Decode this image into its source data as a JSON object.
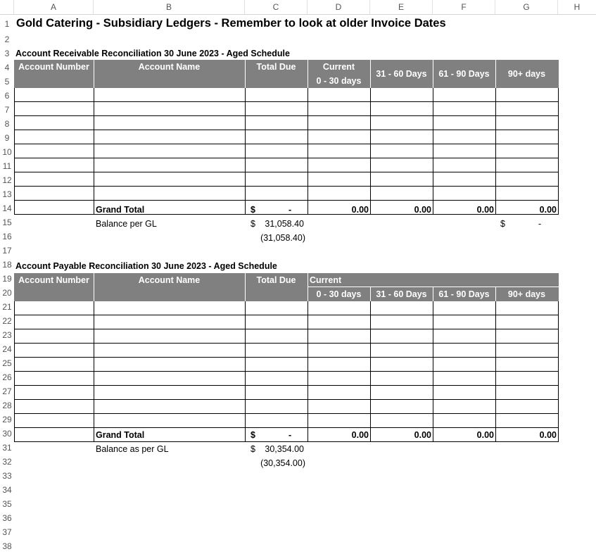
{
  "columns": [
    "A",
    "B",
    "C",
    "D",
    "E",
    "F",
    "G",
    "H"
  ],
  "title": "Gold Catering - Subsidiary Ledgers - Remember to look at older Invoice Dates",
  "ar": {
    "heading": "Account Receivable Reconciliation 30 June 2023 - Aged Schedule",
    "headers": {
      "account_number": "Account Number",
      "account_name": "Account Name",
      "total_due": "Total Due",
      "current": "Current",
      "current_range": "0 - 30 days",
      "d31_60": "31 - 60 Days",
      "d61_90": "61 - 90 Days",
      "d90": "90+ days"
    },
    "grand_total_label": "Grand Total",
    "grand_total_currency": "$",
    "grand_total_dash": "-",
    "totals": [
      "0.00",
      "0.00",
      "0.00",
      "0.00"
    ],
    "balance_label": "Balance per GL",
    "balance_currency": "$",
    "balance_value": "31,058.40",
    "difference": "(31,058.40)",
    "g15_currency": "$",
    "g15_dash": "-"
  },
  "ap": {
    "heading": "Account Payable Reconciliation 30 June 2023 - Aged Schedule",
    "headers": {
      "account_number": "Account Number",
      "account_name": "Account Name",
      "total_due": "Total Due",
      "current": "Current",
      "current_range": "0 - 30 days",
      "d31_60": "31 - 60 Days",
      "d61_90": "61 - 90 Days",
      "d90": "90+ days"
    },
    "grand_total_label": "Grand Total",
    "grand_total_currency": "$",
    "grand_total_dash": "-",
    "totals": [
      "0.00",
      "0.00",
      "0.00",
      "0.00"
    ],
    "balance_label": "Balance as per GL",
    "balance_currency": "$",
    "balance_value": "30,354.00",
    "difference": "(30,354.00)"
  }
}
